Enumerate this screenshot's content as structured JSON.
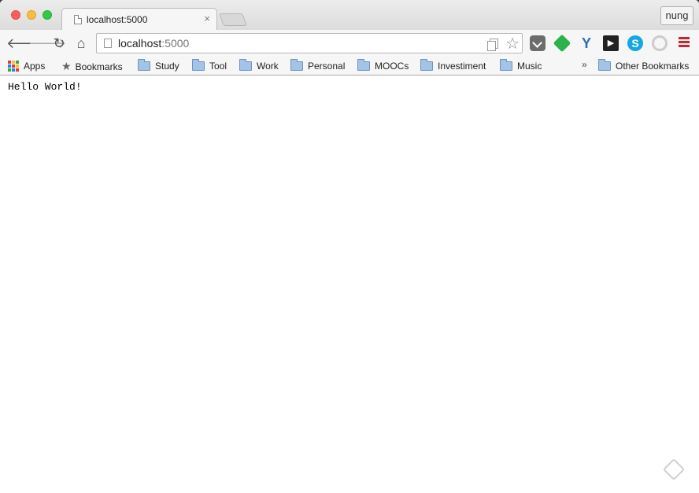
{
  "tab": {
    "title": "localhost:5000",
    "close_glyph": "×"
  },
  "profile": {
    "name": "nung"
  },
  "toolbar": {
    "back_glyph": "🡐",
    "forward_glyph": "🡒",
    "reload_glyph": "↻",
    "home_glyph": "⌂",
    "url_host": "localhost",
    "url_port": ":5000",
    "star_glyph": "☆"
  },
  "extensions": {
    "y_label": "Y",
    "play_label": "▶",
    "skype_label": "S"
  },
  "bookmarks": {
    "apps": "Apps",
    "bookmarks": "Bookmarks",
    "folders": [
      "Study",
      "Tool",
      "Work",
      "Personal",
      "MOOCs",
      "Investiment",
      "Music"
    ],
    "overflow": "»",
    "other": "Other Bookmarks"
  },
  "page": {
    "text": "Hello World!"
  },
  "colors": {
    "close": "#fc605c",
    "minimize": "#fdbc40",
    "maximize": "#34c84a",
    "menu_red": "#c8252c"
  }
}
